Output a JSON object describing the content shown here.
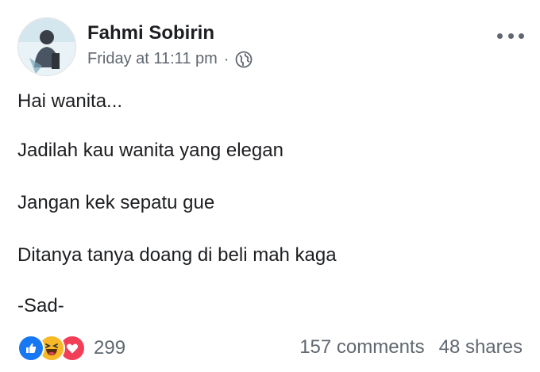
{
  "post": {
    "author": "Fahmi Sobirin",
    "timestamp": "Friday at 11:11 pm",
    "separator": "·",
    "privacy_icon": "globe-icon",
    "more_icon": "more-options-icon",
    "lines": [
      "Hai wanita...",
      "Jadilah kau wanita yang elegan",
      "Jangan kek sepatu gue",
      "Ditanya tanya doang di beli mah kaga",
      "-Sad-"
    ],
    "reactions": {
      "icons": [
        "like-icon",
        "haha-icon",
        "love-icon"
      ],
      "count": "299"
    },
    "comments": "157 comments",
    "shares": "48 shares"
  },
  "colors": {
    "like": "#1877f2",
    "haha": "#f7b928",
    "love": "#f33e58",
    "meta_text": "#616770"
  }
}
